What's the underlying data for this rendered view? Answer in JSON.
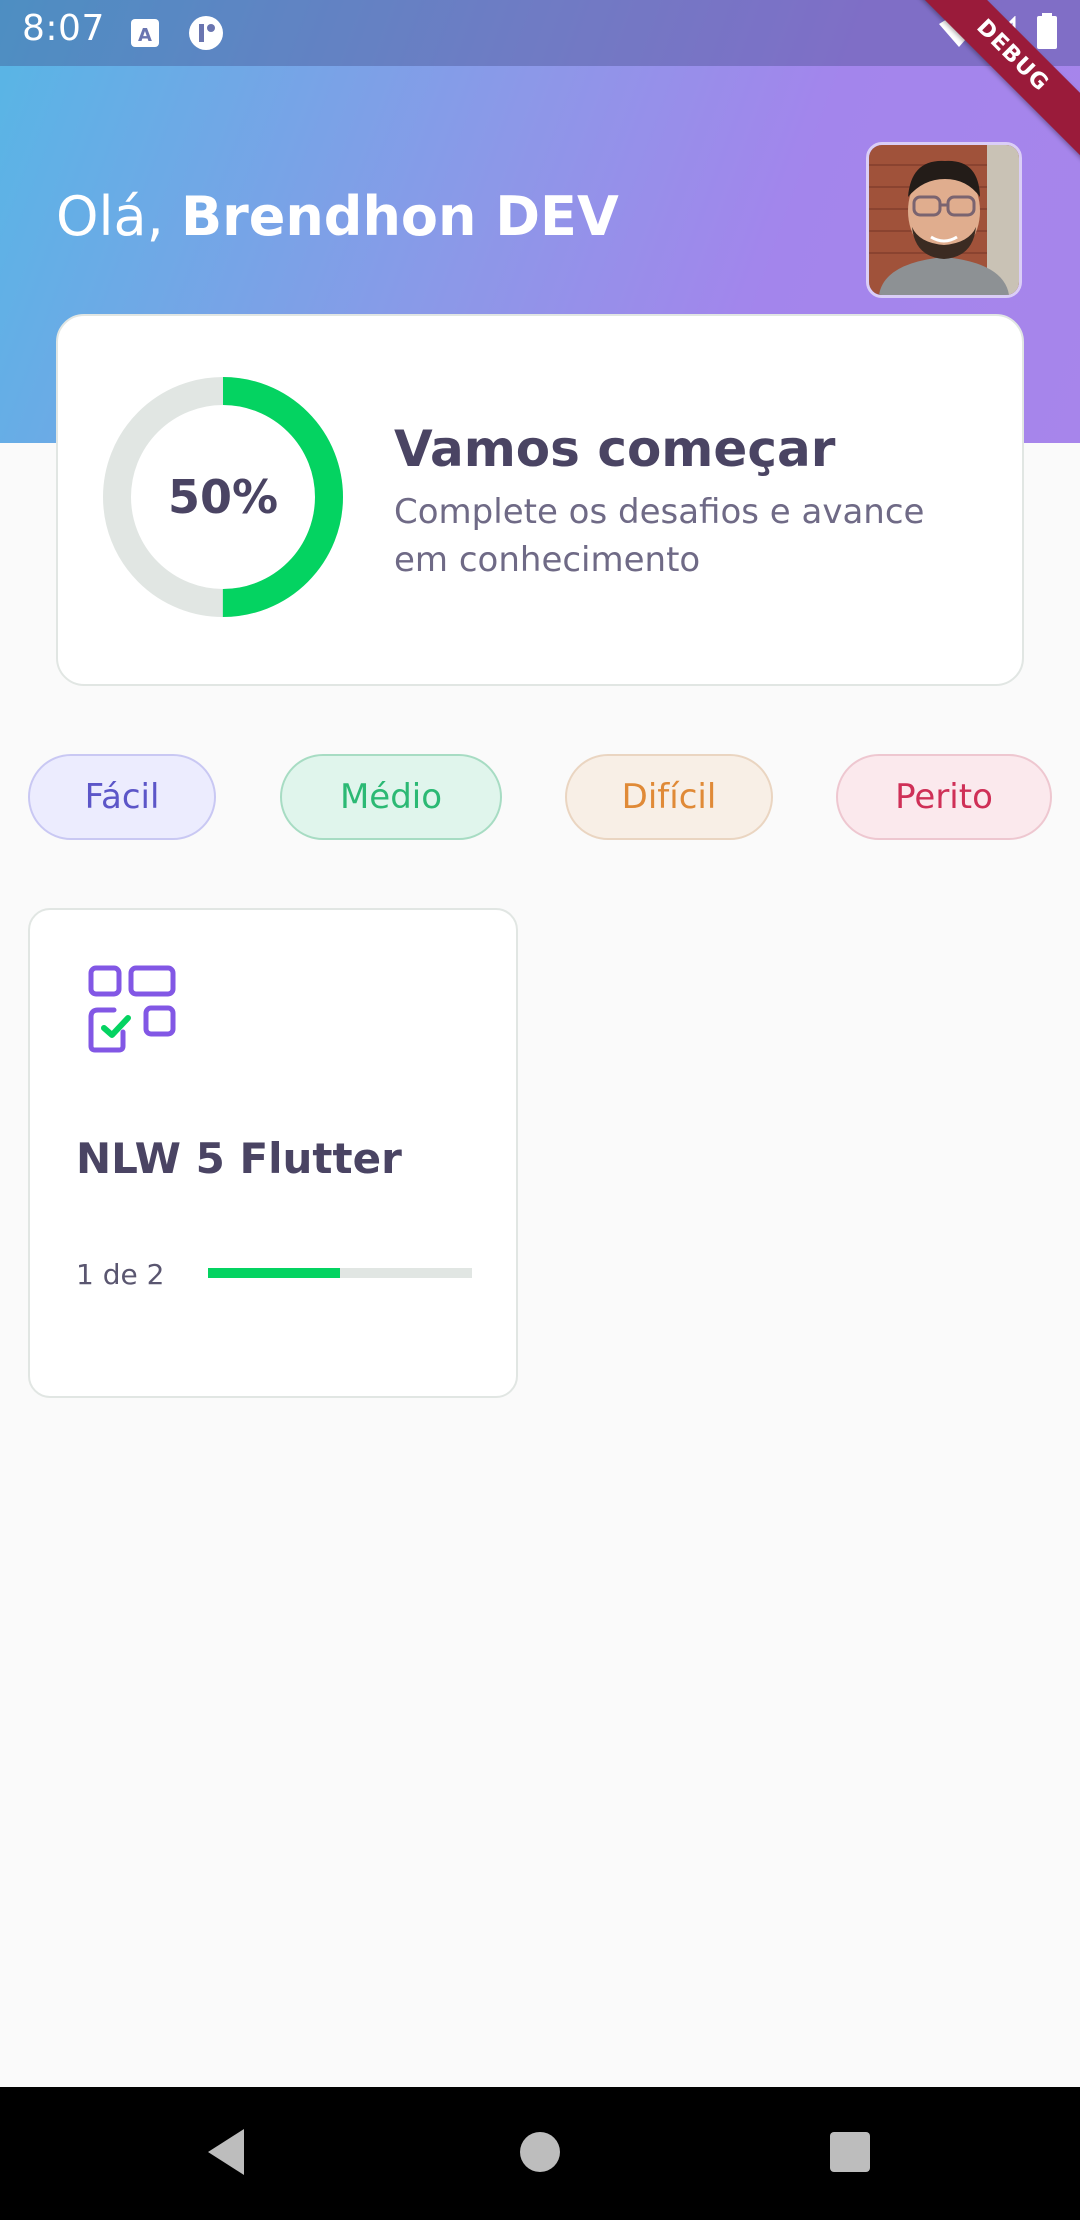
{
  "status_bar": {
    "time": "8:07",
    "debug_label": "DEBUG"
  },
  "header": {
    "greeting_prefix": "Olá, ",
    "user_name": "Brendhon DEV"
  },
  "score_card": {
    "percent_label": "50%",
    "progress": 0.5,
    "title": "Vamos começar",
    "subtitle": "Complete os desafios e avance em conhecimento",
    "colors": {
      "track": "#e1e6e3",
      "fill": "#04d361"
    }
  },
  "levels": [
    {
      "label": "Fácil"
    },
    {
      "label": "Médio"
    },
    {
      "label": "Difícil"
    },
    {
      "label": "Perito"
    }
  ],
  "quizzes": [
    {
      "title": "NLW 5 Flutter",
      "progress_text": "1 de 2",
      "progress": 0.5,
      "icon": "checklist-icon"
    }
  ],
  "theme": {
    "accent_purple": "#8257e5",
    "accent_green": "#04d361",
    "text_dark": "#4a4463"
  }
}
